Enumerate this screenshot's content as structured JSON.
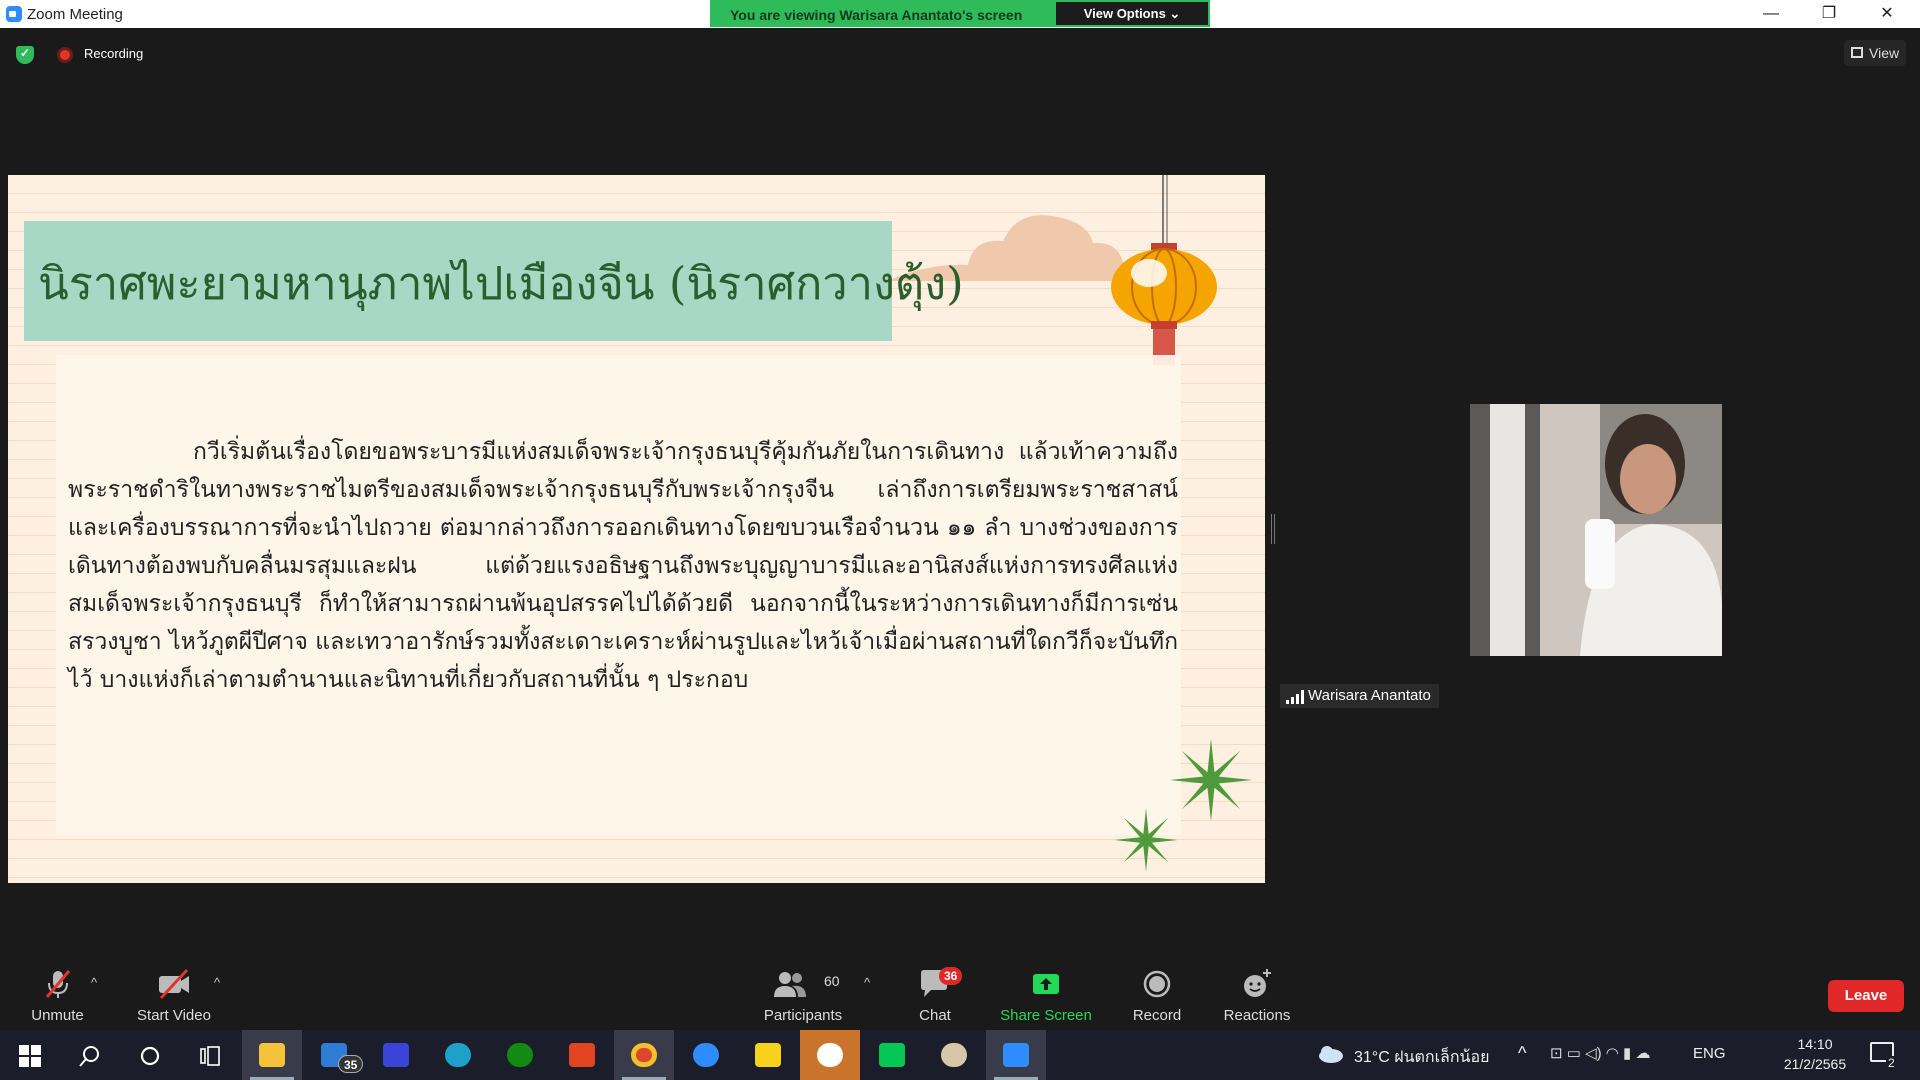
{
  "window": {
    "title": "Zoom Meeting",
    "minimize": "—",
    "restore": "❐",
    "close": "✕"
  },
  "banner": {
    "message": "You are viewing Warisara Anantato's screen",
    "view_options": "View Options ⌄"
  },
  "meeting_bar": {
    "recording": "Recording",
    "view": "View"
  },
  "slide": {
    "title": "นิราศพะยามหานุภาพไปเมืองจีน (นิราศกวางตุ้ง)",
    "body": "กวีเริ่มต้นเรื่องโดยขอพระบารมีแห่งสมเด็จพระเจ้ากรุงธนบุรีคุ้มกันภัยในการเดินทาง แล้วเท้าความถึงพระราชดำริในทางพระราชไมตรีของสมเด็จพระเจ้ากรุงธนบุรีกับพระเจ้ากรุงจีน เล่าถึงการเตรียมพระราชสาสน์และเครื่องบรรณาการที่จะนำไปถวาย ต่อมากล่าวถึงการออกเดินทางโดยขบวนเรือจำนวน ๑๑ ลำ บางช่วงของการเดินทางต้องพบกับคลื่นมรสุมและฝน แต่ด้วยแรงอธิษฐานถึงพระบุญญาบารมีและอานิสงส์แห่งการทรงศีลแห่งสมเด็จพระเจ้ากรุงธนบุรี ก็ทำให้สามารถผ่านพ้นอุปสรรคไปได้ด้วยดี นอกจากนี้ในระหว่างการเดินทางก็มีการเซ่นสรวงบูชา ไหว้ภูตผีปีศาจ และเทวาอารักษ์รวมทั้งสะเดาะเคราะห์ผ่านรูปและไหว้เจ้าเมื่อผ่านสถานที่ใดกวีก็จะบันทึกไว้ บางแห่งก็เล่าตามตำนานและนิทานที่เกี่ยวกับสถานที่นั้น ๆ ประกอบ"
  },
  "participant": {
    "name": "Warisara Anantato"
  },
  "toolbar": {
    "unmute": "Unmute",
    "start_video": "Start Video",
    "participants": "Participants",
    "participants_count": "60",
    "chat": "Chat",
    "chat_badge": "36",
    "share_screen": "Share Screen",
    "record": "Record",
    "reactions": "Reactions",
    "leave": "Leave"
  },
  "taskbar": {
    "mail_badge": "35",
    "weather": "31°C  ฝนตกเล็กน้อย",
    "lang": "ENG",
    "time": "14:10",
    "date": "21/2/2565",
    "notif_count": "2"
  },
  "colors": {
    "banner_green": "#2fbb5a",
    "leave_red": "#e02828",
    "share_green": "#23d959",
    "slide_bg": "#fdf0e1",
    "title_box": "#a9d7c5",
    "title_text": "#2b5e2c"
  }
}
